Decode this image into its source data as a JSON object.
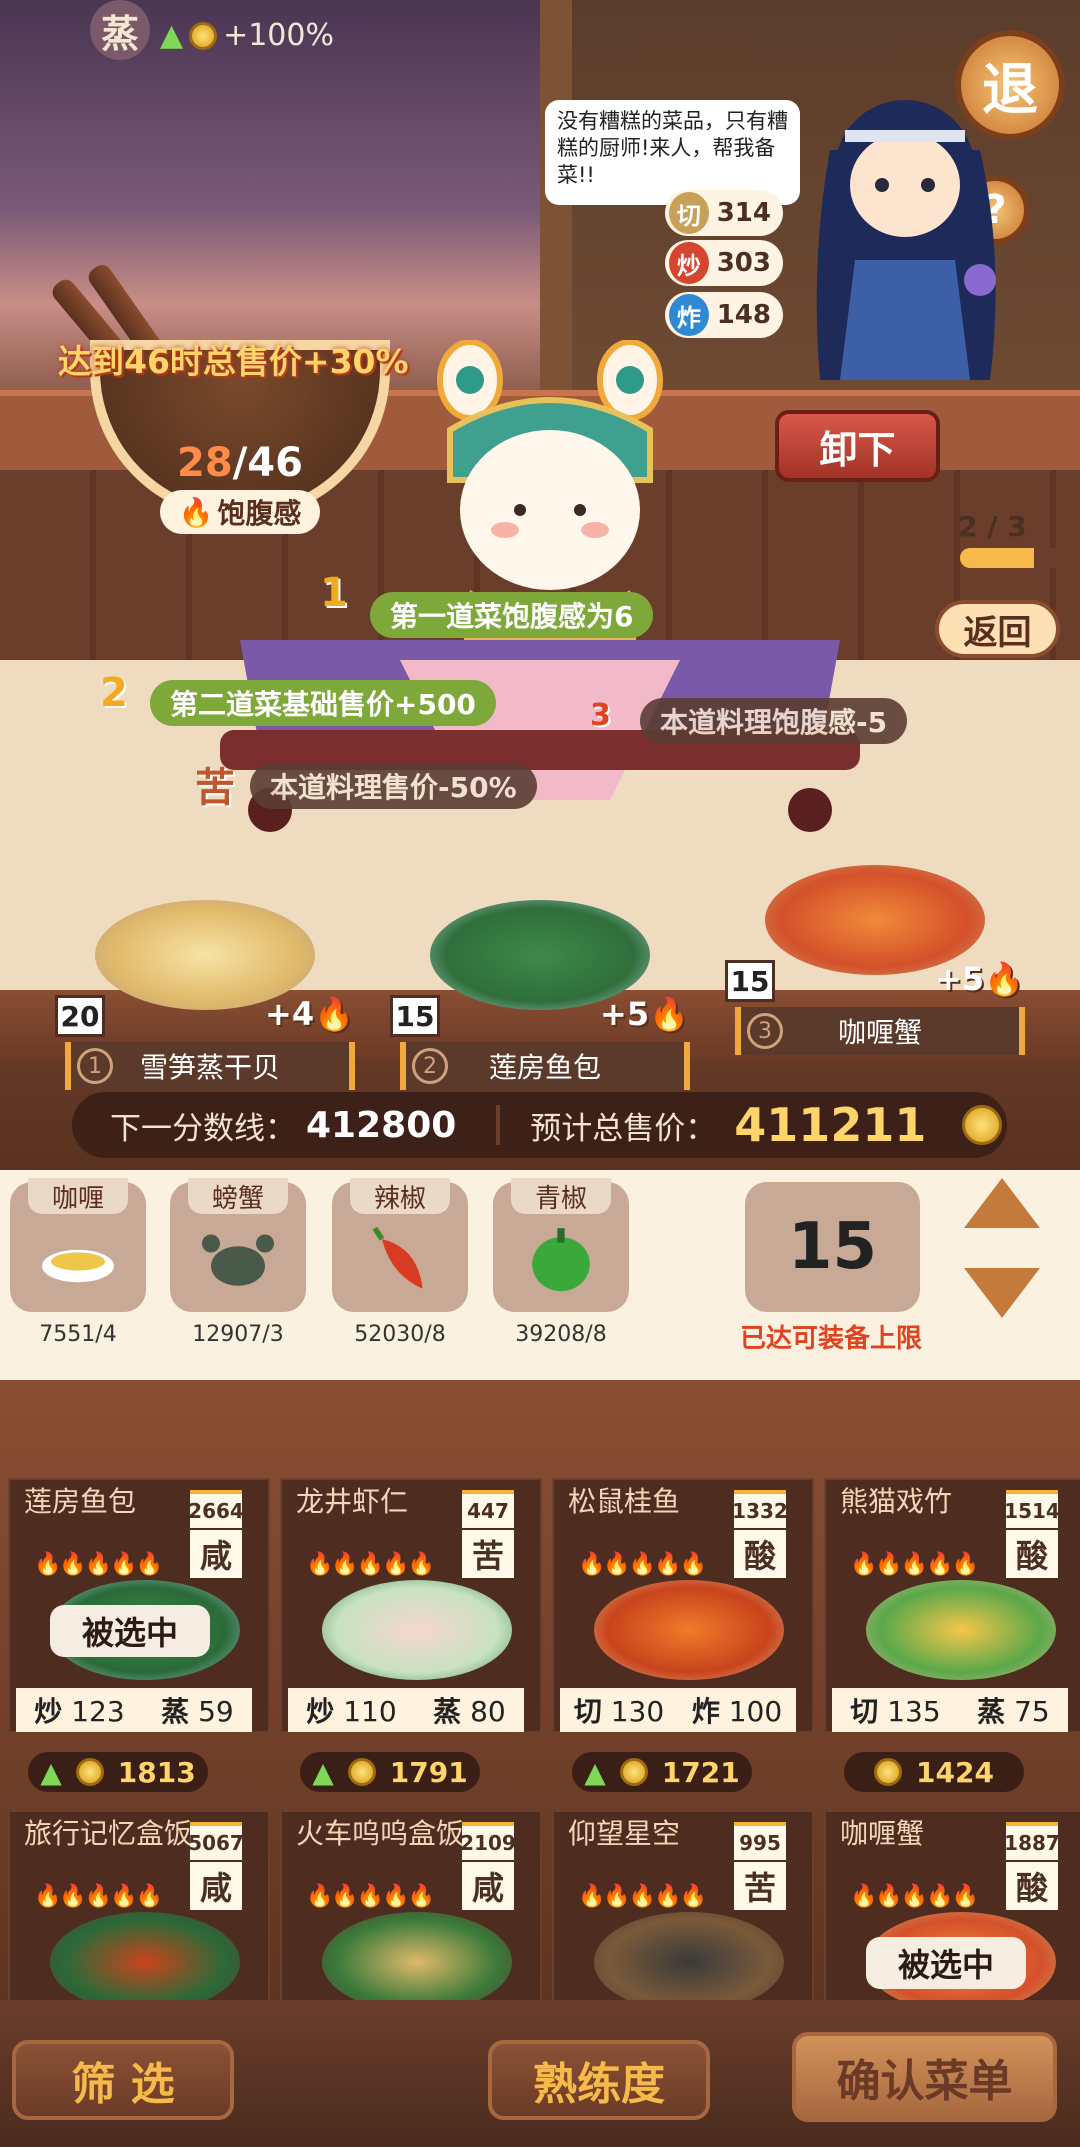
{
  "header": {
    "steam_label": "蒸",
    "steam_bonus": "+100%",
    "exit_label": "退",
    "help_label": "?"
  },
  "chef": {
    "speech": "没有糟糕的菜品，只有糟糕的厨师!来人，帮我备菜!!",
    "skills": [
      {
        "icon": "切",
        "value": "314"
      },
      {
        "icon": "炒",
        "value": "303"
      },
      {
        "icon": "炸",
        "value": "148"
      }
    ]
  },
  "satiety": {
    "bonus_text": "达到46时总售价+30%",
    "current": "28",
    "target": "/46",
    "label": "饱腹感"
  },
  "controls": {
    "unload": "卸下",
    "page": "2 / 3",
    "page_progress": 0.67,
    "back": "返回"
  },
  "effects": [
    {
      "badge": "1",
      "text": "第一道菜饱腹感为6"
    },
    {
      "badge": "2",
      "text": "第二道菜基础售价+500"
    },
    {
      "badge": "3",
      "text": "本道料理饱腹感-5"
    },
    {
      "badge": "苦",
      "text": "本道料理售价-50%"
    }
  ],
  "slots": [
    {
      "level": "20",
      "bonus": "+4",
      "index": "1",
      "name": "雪笋蒸干贝"
    },
    {
      "level": "15",
      "bonus": "+5",
      "index": "2",
      "name": "莲房鱼包"
    },
    {
      "level": "15",
      "bonus": "+5",
      "index": "3",
      "name": "咖喱蟹"
    }
  ],
  "score": {
    "next_label": "下一分数线：",
    "next_value": "412800",
    "total_label": "预计总售价：",
    "total_value": "411211"
  },
  "ingredients": [
    {
      "name": "咖喱",
      "count": "7551/4",
      "icon": "gravy-boat-icon"
    },
    {
      "name": "螃蟹",
      "count": "12907/3",
      "icon": "crab-icon"
    },
    {
      "name": "辣椒",
      "count": "52030/8",
      "icon": "chili-icon"
    },
    {
      "name": "青椒",
      "count": "39208/8",
      "icon": "green-pepper-icon"
    }
  ],
  "equip": {
    "value": "15",
    "limit_text": "已达可装备上限"
  },
  "dishes": [
    {
      "name": "莲房鱼包",
      "popularity": "2664",
      "taste": "咸",
      "s1": "炒",
      "v1": "123",
      "s2": "蒸",
      "v2": "59",
      "price": "1813",
      "up": true,
      "selected": true
    },
    {
      "name": "龙井虾仁",
      "popularity": "447",
      "taste": "苦",
      "s1": "炒",
      "v1": "110",
      "s2": "蒸",
      "v2": "80",
      "price": "1791",
      "up": true,
      "selected": false
    },
    {
      "name": "松鼠桂鱼",
      "popularity": "1332",
      "taste": "酸",
      "s1": "切",
      "v1": "130",
      "s2": "炸",
      "v2": "100",
      "price": "1721",
      "up": true,
      "selected": false
    },
    {
      "name": "熊猫戏竹",
      "popularity": "1514",
      "taste": "酸",
      "s1": "切",
      "v1": "135",
      "s2": "蒸",
      "v2": "75",
      "price": "1424",
      "up": false,
      "selected": false
    },
    {
      "name": "旅行记忆盒饭",
      "popularity": "5067",
      "taste": "咸"
    },
    {
      "name": "火车呜呜盒饭",
      "popularity": "2109",
      "taste": "咸"
    },
    {
      "name": "仰望星空",
      "popularity": "995",
      "taste": "苦"
    },
    {
      "name": "咖喱蟹",
      "popularity": "1887",
      "taste": "酸",
      "selected": true
    }
  ],
  "selected_label": "被选中",
  "bottom": {
    "filter": "筛 选",
    "proficiency": "熟练度",
    "confirm": "确认菜单"
  },
  "colors": {
    "accent": "#f6b94a",
    "danger": "#e0441e",
    "panel": "#4e2d20"
  }
}
